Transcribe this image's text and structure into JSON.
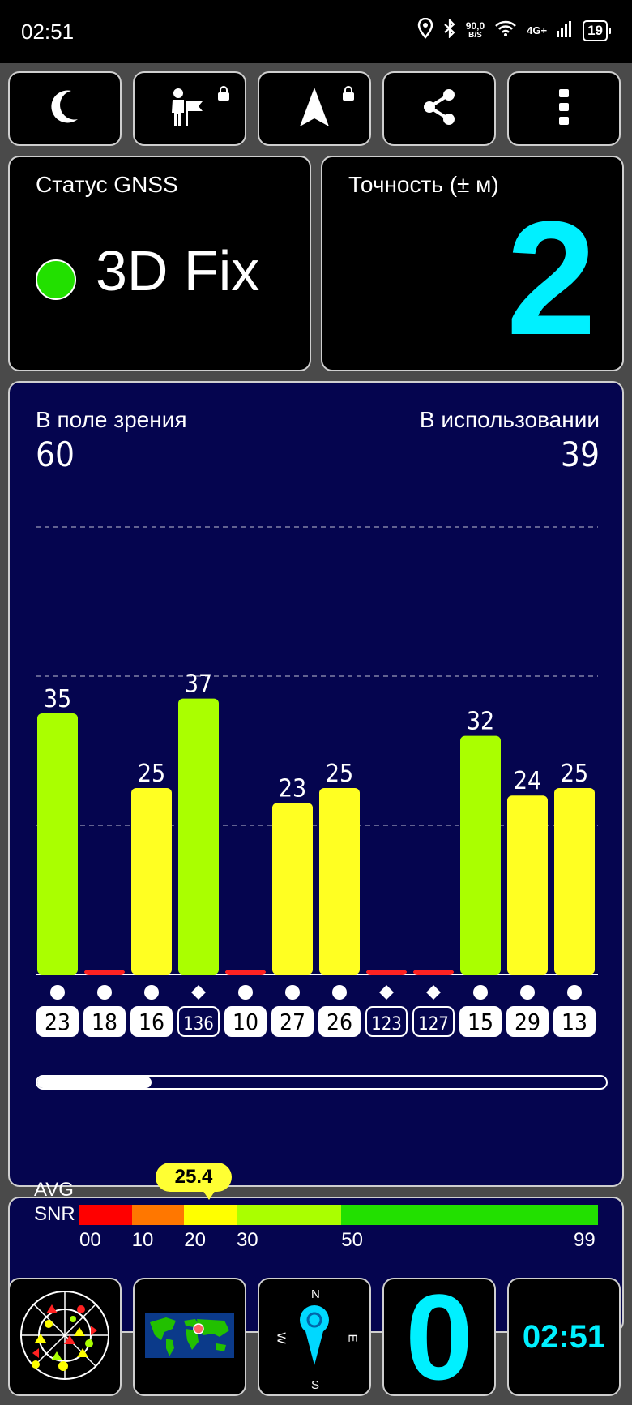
{
  "status_bar": {
    "time": "02:51",
    "speed_value": "90,0",
    "speed_unit": "B/S",
    "network": "4G+",
    "battery": "19",
    "icons": [
      "location-icon",
      "bluetooth-icon",
      "wifi-icon",
      "signal-icon",
      "battery-icon"
    ]
  },
  "toolbar": {
    "buttons": [
      "moon-icon",
      "person-flag-icon",
      "navigation-arrow-icon",
      "share-icon",
      "more-vert-icon"
    ]
  },
  "gnss": {
    "label": "Статус GNSS",
    "value": "3D Fix",
    "indicator_color": "#22e000"
  },
  "accuracy": {
    "label": "Точность (± м)",
    "value": "2",
    "color": "#00f0ff"
  },
  "satellites": {
    "in_view_label": "В поле зрения",
    "in_view": "60",
    "in_use_label": "В использовании",
    "in_use": "39",
    "scroll_fraction": 0.2
  },
  "chart_data": {
    "type": "bar",
    "categories": [
      "23",
      "18",
      "16",
      "136",
      "10",
      "27",
      "26",
      "123",
      "127",
      "15",
      "29",
      "13"
    ],
    "values": [
      35,
      0,
      25,
      37,
      0,
      23,
      25,
      0,
      0,
      32,
      24,
      25
    ],
    "value_labels": [
      "35",
      "",
      "25",
      "37",
      "",
      "23",
      "25",
      "",
      "",
      "32",
      "24",
      "25"
    ],
    "markers": [
      "circle",
      "circle",
      "circle",
      "diamond",
      "circle",
      "circle",
      "circle",
      "diamond",
      "diamond",
      "circle",
      "circle",
      "circle"
    ],
    "ylim": [
      0,
      60
    ],
    "grid": true,
    "colors": {
      "high": "#aaff00",
      "mid": "#ffff22",
      "none": "#ff2222"
    }
  },
  "snr": {
    "label_line1": "AVG",
    "label_line2": "SNR",
    "avg": "25.4",
    "scale": [
      {
        "label": "00",
        "value": 0,
        "color": "#ff0000"
      },
      {
        "label": "10",
        "value": 10,
        "color": "#ff7700"
      },
      {
        "label": "20",
        "value": 20,
        "color": "#ffff00"
      },
      {
        "label": "30",
        "value": 30,
        "color": "#aaff00"
      },
      {
        "label": "50",
        "value": 50,
        "color": "#22e000"
      },
      {
        "label": "99",
        "value": 99,
        "color": ""
      }
    ]
  },
  "bottom": {
    "count": "0",
    "clock": "02:51",
    "compass": {
      "n": "N",
      "s": "S",
      "e": "E",
      "w": "W"
    }
  }
}
